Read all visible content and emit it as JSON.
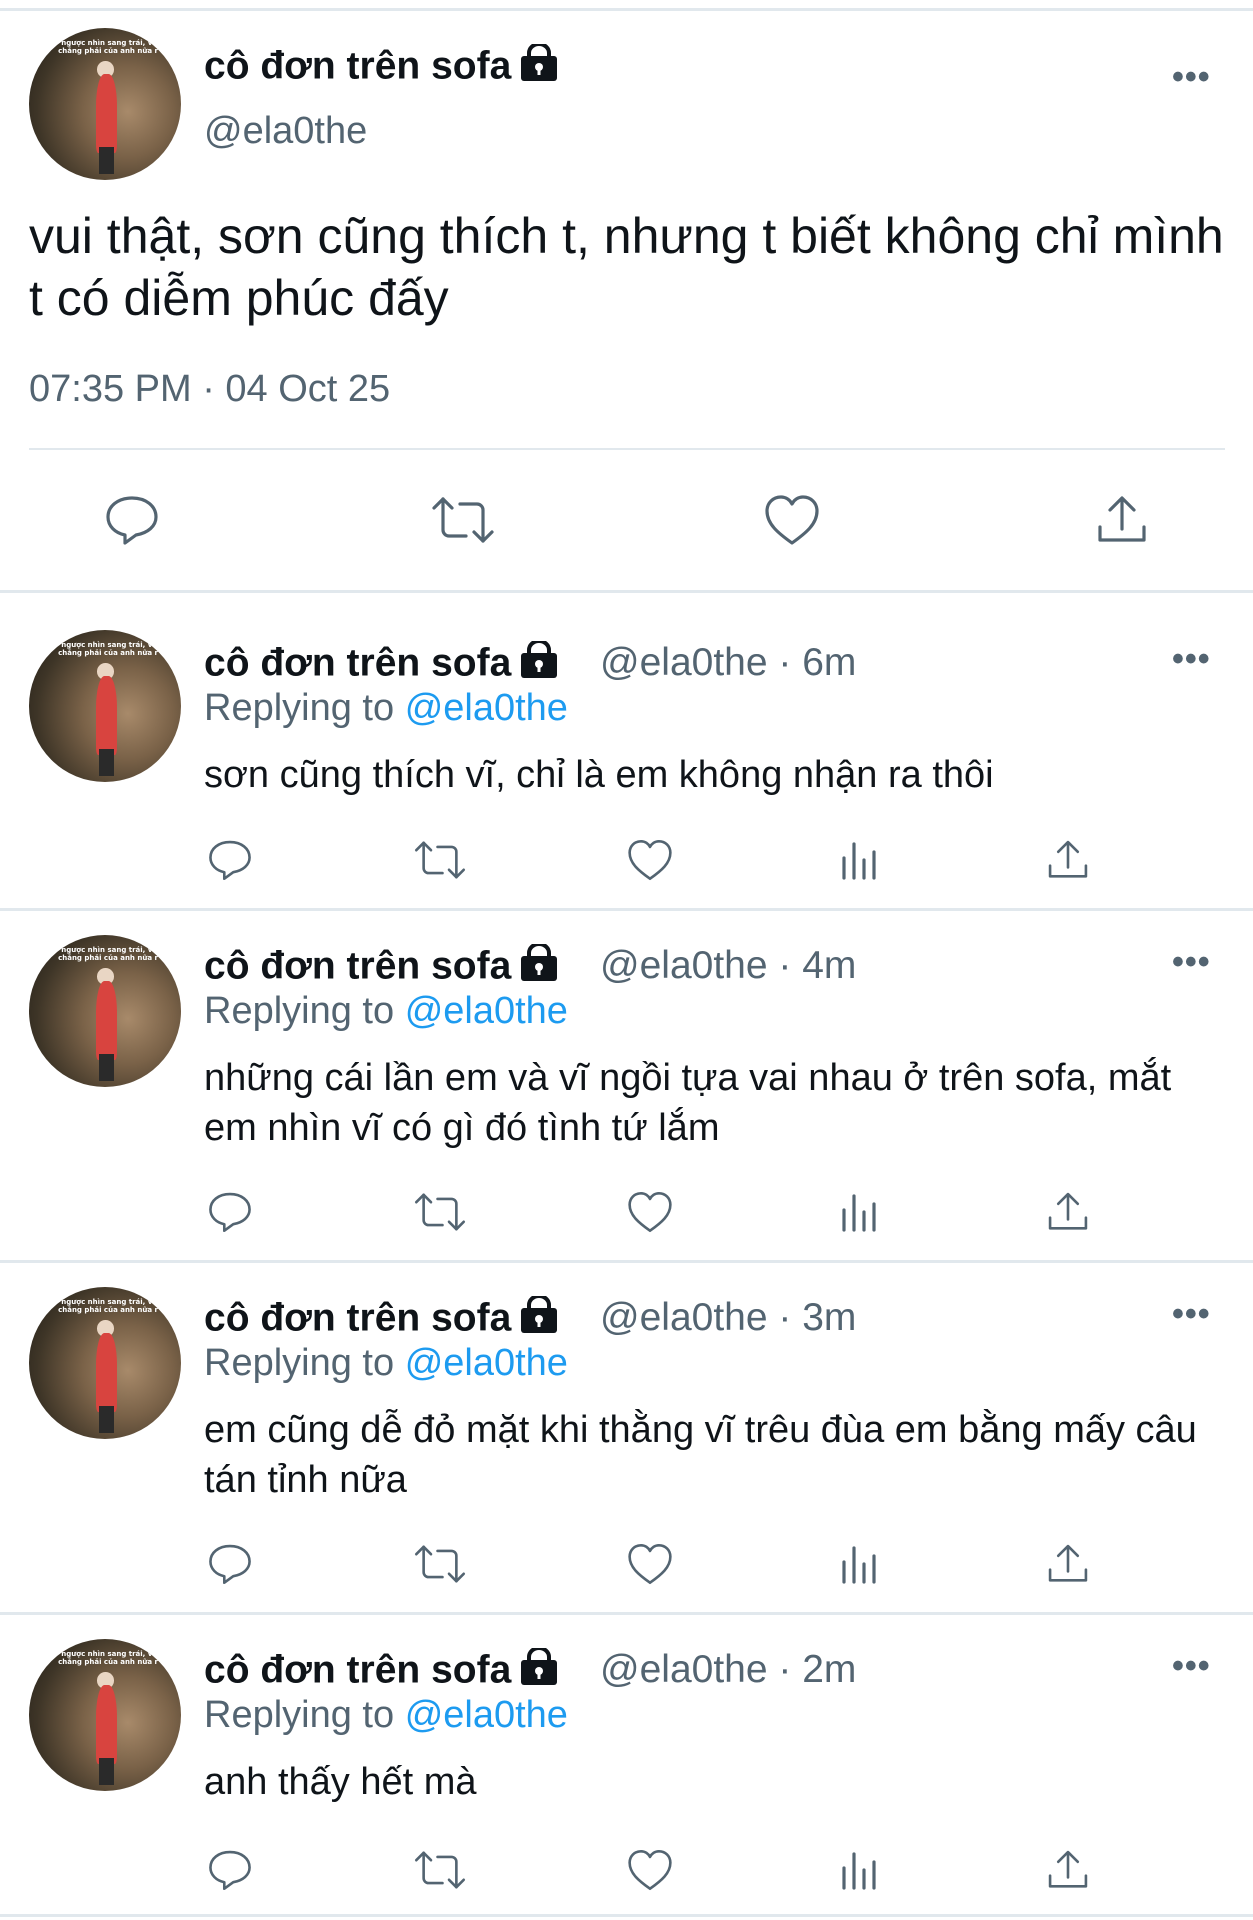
{
  "main_tweet": {
    "display_name": "cô đơn trên sofa",
    "handle": "@ela0the",
    "text": "vui thật, sơn cũng thích t, nhưng t biết không chỉ mình t có diễm phúc đấy",
    "timestamp": "07:35 PM · 04 Oct 25",
    "more_label": "•••",
    "avatar_caption": "ngược nhìn sang trái, vì chẳng phải của anh nữa r",
    "actions": [
      "reply-icon",
      "retweet-icon",
      "like-icon",
      "share-icon"
    ]
  },
  "replies": [
    {
      "display_name": "cô đơn trên sofa",
      "handle_time": "@ela0the · 6m",
      "replying_prefix": "Replying to",
      "replying_mention": "@ela0the",
      "text": "sơn cũng thích vĩ, chỉ là em không nhận ra thôi",
      "more_label": "•••"
    },
    {
      "display_name": "cô đơn trên sofa",
      "handle_time": "@ela0the · 4m",
      "replying_prefix": "Replying to",
      "replying_mention": "@ela0the",
      "text": "những cái lần em và vĩ ngồi tựa vai nhau ở trên sofa, mắt em nhìn vĩ có gì đó tình tứ lắm",
      "more_label": "•••"
    },
    {
      "display_name": "cô đơn trên sofa",
      "handle_time": "@ela0the · 3m",
      "replying_prefix": "Replying to",
      "replying_mention": "@ela0the",
      "text": "em cũng dễ đỏ mặt khi thằng vĩ trêu đùa em bằng mấy câu tán tỉnh nữa",
      "more_label": "•••"
    },
    {
      "display_name": "cô đơn trên sofa",
      "handle_time": "@ela0the · 2m",
      "replying_prefix": "Replying to",
      "replying_mention": "@ela0the",
      "text": "anh thấy hết mà",
      "more_label": "•••"
    }
  ],
  "colors": {
    "text": "#0f1419",
    "secondary": "#536471",
    "link": "#1d9bf0",
    "divider": "#e1e8ed"
  }
}
